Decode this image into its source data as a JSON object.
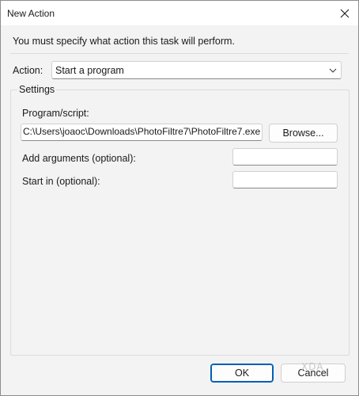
{
  "window": {
    "title": "New Action"
  },
  "instruction": "You must specify what action this task will perform.",
  "action": {
    "label": "Action:",
    "selected": "Start a program"
  },
  "settings": {
    "group_label": "Settings",
    "program": {
      "label": "Program/script:",
      "value": "C:\\Users\\joaoc\\Downloads\\PhotoFiltre7\\PhotoFiltre7.exe"
    },
    "browse_label": "Browse...",
    "arguments": {
      "label": "Add arguments (optional):",
      "value": ""
    },
    "start_in": {
      "label": "Start in (optional):",
      "value": ""
    }
  },
  "buttons": {
    "ok": "OK",
    "cancel": "Cancel"
  },
  "watermark": "XDA",
  "icons": {
    "close": "close-icon",
    "dropdown": "chevron-down-icon"
  },
  "colors": {
    "accent": "#005fb8",
    "window_bg": "#f3f3f3",
    "title_bg": "#ffffff"
  }
}
